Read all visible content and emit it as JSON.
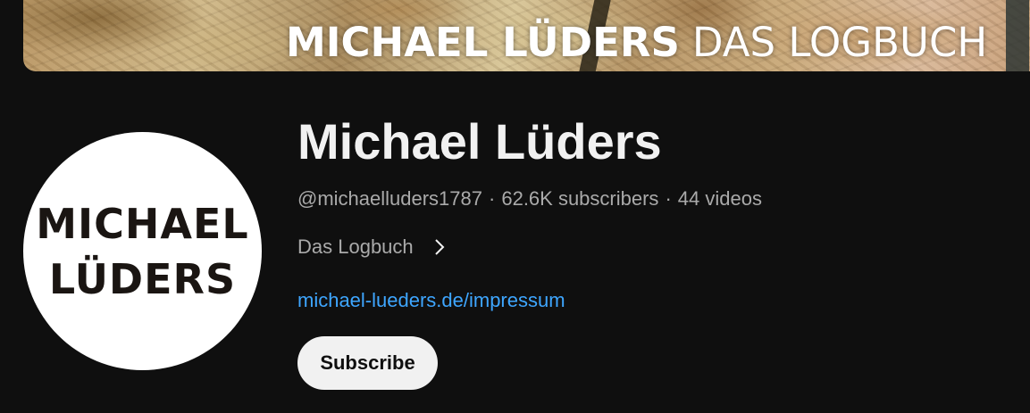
{
  "banner": {
    "title_bold": "MICHAEL LÜDERS",
    "title_light": "DAS LOGBUCH"
  },
  "avatar": {
    "line1": "MICHAEL",
    "line2": "LÜDERS"
  },
  "channel": {
    "name": "Michael Lüders",
    "handle": "@michaelluders1787",
    "separator": "·",
    "subscribers": "62.6K subscribers",
    "videos": "44 videos",
    "description": "Das Logbuch",
    "link": "michael-lueders.de/impressum",
    "subscribe_label": "Subscribe"
  },
  "icons": {
    "about": "chevron-right-icon"
  },
  "colors": {
    "background": "#0f0f0f",
    "primary_text": "#f1f1f1",
    "secondary_text": "#aaaaaa",
    "link": "#3ea6ff",
    "button_bg": "#f1f1f1"
  }
}
